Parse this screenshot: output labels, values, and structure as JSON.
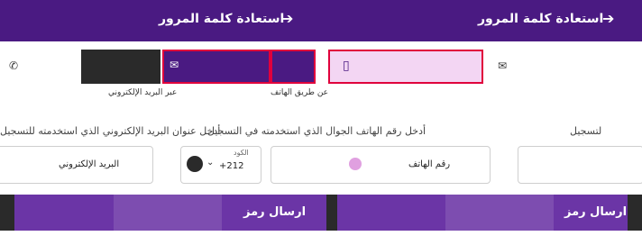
{
  "header": {
    "title": "استعادة كلمة المرور",
    "back_arrow": "➔"
  },
  "tabs": [
    {
      "label": "عبر البريد الإلكتروني",
      "icon": "mail-icon"
    },
    {
      "label": "عن طريق الهاتف",
      "icon": "phone-icon"
    }
  ],
  "form": {
    "instruction_email": "أدخل عنوان البريد الإلكتروني الذي استخدمته للتسجيل",
    "instruction_phone": "أدخل رقم الهاتف الجوال الذي استخدمته في التسجيل",
    "instruction_right": "لتسجيل",
    "email_field_label": "البريد الإلكتروني",
    "phone_field_label": "رقم الهاتف",
    "country_code_caption": "الكود",
    "country_code": "+212",
    "send_button_label": "ارسال رمز"
  },
  "colors": {
    "brand_purple": "#4a1a82",
    "button_purple": "#6b35a6",
    "tab_pink": "#f3d6f3",
    "selected_outline": "#e0003c"
  }
}
